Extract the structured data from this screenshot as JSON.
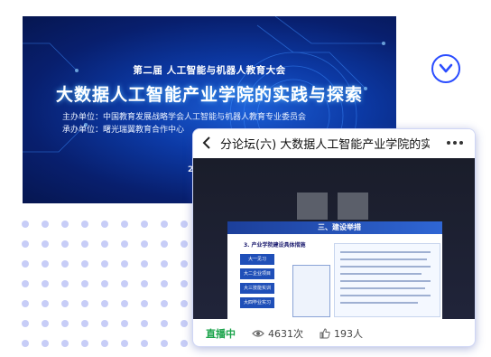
{
  "banner": {
    "subtitle": "第二届 人工智能与机器人教育大会",
    "title": "大数据人工智能产业学院的实践与探索",
    "organizer": "主办单位：中国教育发展战略学会人工智能与机器人教育专业委员会",
    "co_organizer": "承办单位：曙光瑞翼教育合作中心",
    "date_fragment": "2"
  },
  "phone": {
    "title": "分论坛(六) 大数据人工智能产业学院的实...",
    "slide": {
      "header": "三、建设举措",
      "heading": "3. 产业学院建设具体措施",
      "labels": [
        "大一见习",
        "大二企业项目",
        "大三技能实训",
        "大四毕业实习"
      ]
    },
    "live_label": "直播中",
    "views": "4631次",
    "likes": "193人"
  },
  "colors": {
    "accent": "#2b4dff",
    "live": "#1aa34a",
    "banner_bg": "#0c3aa6"
  },
  "icons": [
    "back-icon",
    "more-icon",
    "chevron-down-icon",
    "eye-icon",
    "thumb-up-icon"
  ]
}
